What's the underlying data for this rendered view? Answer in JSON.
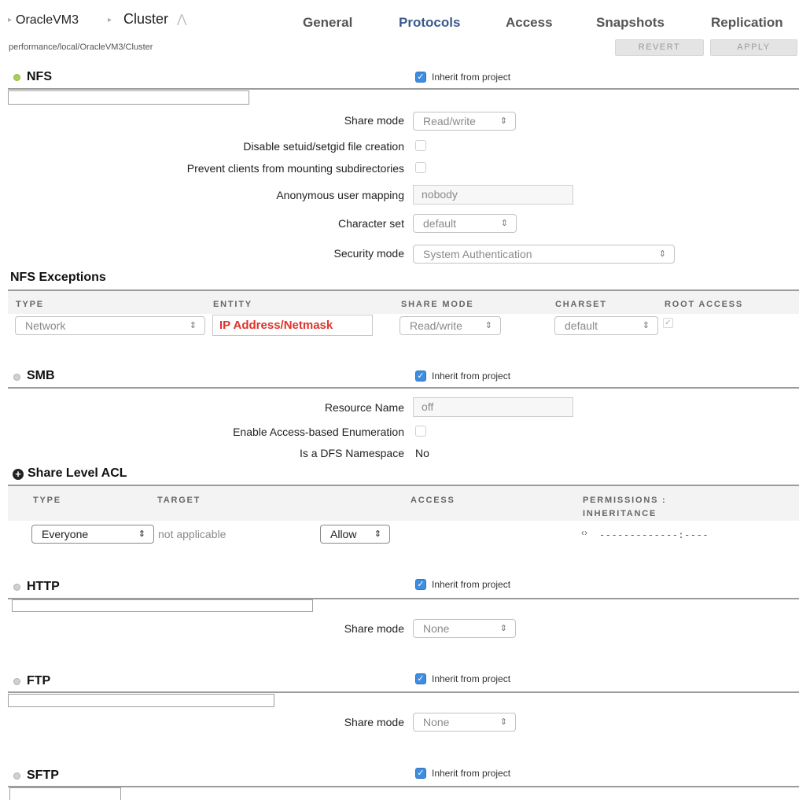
{
  "header": {
    "breadcrumb_1": "OracleVM3",
    "breadcrumb_2": "Cluster",
    "path": "performance/local/OracleVM3/Cluster",
    "tabs": [
      "General",
      "Protocols",
      "Access",
      "Snapshots",
      "Replication"
    ],
    "active_tab": "Protocols",
    "revert_label": "REVERT",
    "apply_label": "APPLY"
  },
  "inherit_label": "Inherit from project",
  "nfs": {
    "title": "NFS",
    "share_mode_label": "Share mode",
    "share_mode_value": "Read/write",
    "disable_setuid_label": "Disable setuid/setgid file creation",
    "prevent_mount_label": "Prevent clients from mounting subdirectories",
    "anon_label": "Anonymous user mapping",
    "anon_value": "nobody",
    "charset_label": "Character set",
    "charset_value": "default",
    "security_label": "Security mode",
    "security_value": "System Authentication"
  },
  "nfs_exceptions": {
    "title": "NFS Exceptions",
    "columns": [
      "TYPE",
      "ENTITY",
      "SHARE MODE",
      "CHARSET",
      "ROOT ACCESS"
    ],
    "row": {
      "type": "Network",
      "entity": "IP Address/Netmask",
      "share_mode": "Read/write",
      "charset": "default"
    }
  },
  "smb": {
    "title": "SMB",
    "resource_label": "Resource Name",
    "resource_value": "off",
    "abe_label": "Enable Access-based Enumeration",
    "dfs_label": "Is a DFS Namespace",
    "dfs_value": "No"
  },
  "share_acl": {
    "title": "Share Level ACL",
    "columns": [
      "TYPE",
      "TARGET",
      "ACCESS",
      "PERMISSIONS :",
      "INHERITANCE"
    ],
    "row": {
      "type": "Everyone",
      "target": "not applicable",
      "access": "Allow",
      "permissions": "-------------:----"
    }
  },
  "http": {
    "title": "HTTP",
    "share_mode_label": "Share mode",
    "share_mode_value": "None"
  },
  "ftp": {
    "title": "FTP",
    "share_mode_label": "Share mode",
    "share_mode_value": "None"
  },
  "sftp": {
    "title": "SFTP"
  },
  "colors": {
    "accent": "#3a5a8c",
    "checkbox_blue": "#3e8de0",
    "entity_red": "#e0332b",
    "status_green": "#a6d05a"
  }
}
